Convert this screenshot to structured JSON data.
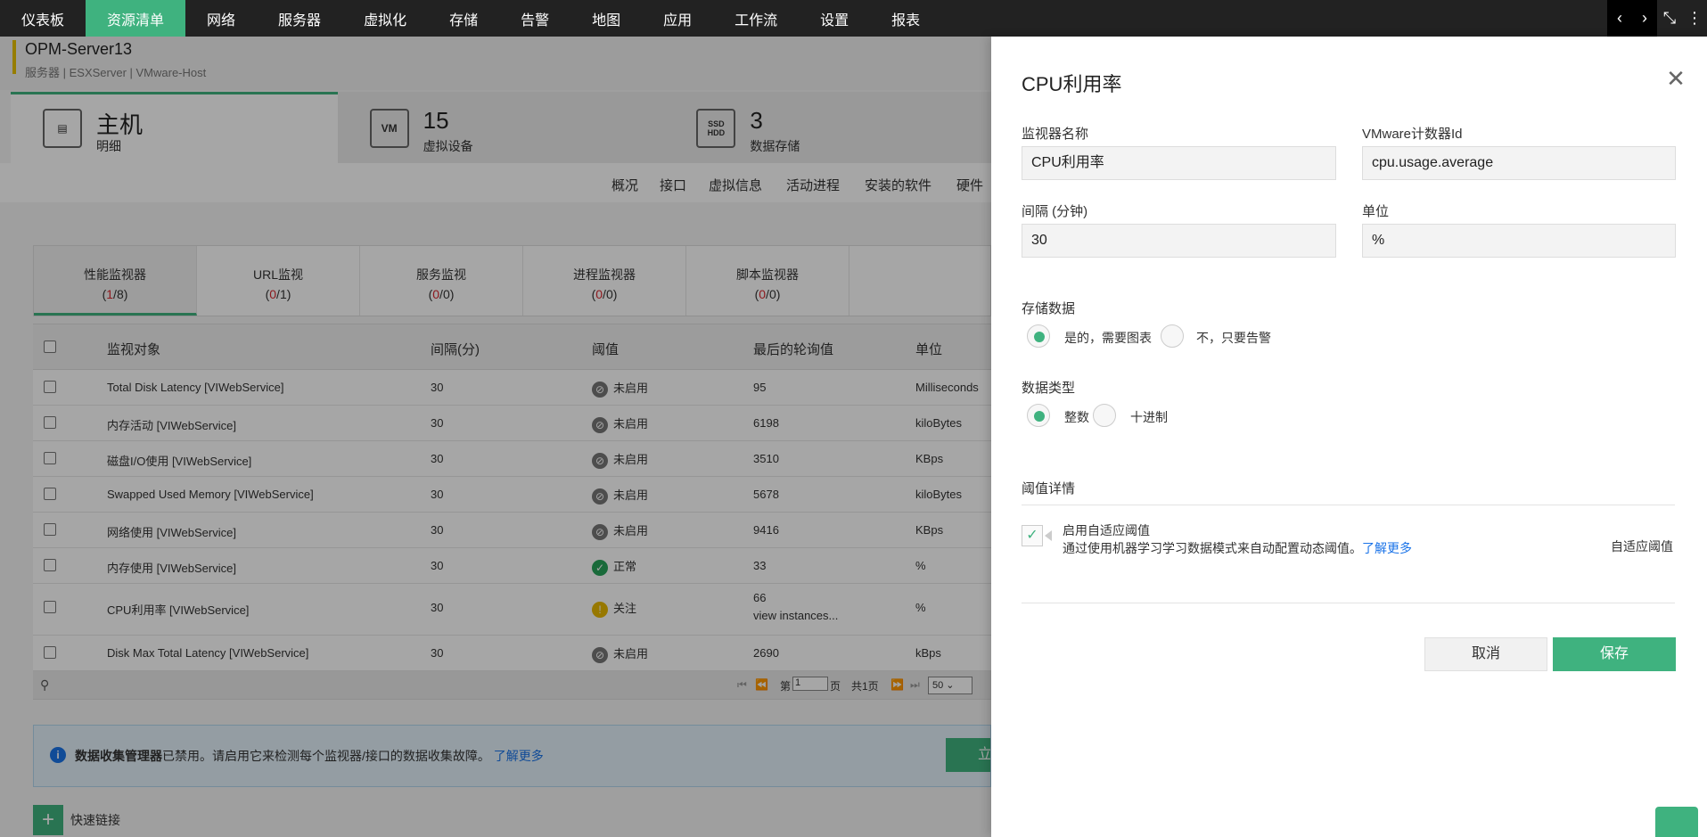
{
  "nav": {
    "items": [
      "仪表板",
      "资源清单",
      "网络",
      "服务器",
      "虚拟化",
      "存储",
      "告警",
      "地图",
      "应用",
      "工作流",
      "设置",
      "报表"
    ],
    "active_index": 1
  },
  "host": {
    "name": "OPM-Server13",
    "breadcrumb": "服务器 | ESXServer | VMware-Host"
  },
  "cards": [
    {
      "icon": "server-rack-icon",
      "big": "主机",
      "sub": "明细"
    },
    {
      "icon": "vm-icon",
      "icon_text": "VM",
      "big": "15",
      "sub": "虚拟设备"
    },
    {
      "icon": "hdd-icon",
      "icon_text": "SSD HDD",
      "big": "3",
      "sub": "数据存储"
    }
  ],
  "subtabs": [
    "概况",
    "接口",
    "虚拟信息",
    "活动进程",
    "安装的软件",
    "硬件"
  ],
  "monitor_tabs": [
    {
      "label": "性能监视器",
      "cnt_a": "1",
      "cnt_b": "8"
    },
    {
      "label": "URL监视",
      "cnt_a": "0",
      "cnt_b": "1"
    },
    {
      "label": "服务监视",
      "cnt_a": "0",
      "cnt_b": "0"
    },
    {
      "label": "进程监视器",
      "cnt_a": "0",
      "cnt_b": "0"
    },
    {
      "label": "脚本监视器",
      "cnt_a": "0",
      "cnt_b": "0"
    }
  ],
  "table": {
    "headers": [
      "监视对象",
      "间隔(分)",
      "阈值",
      "最后的轮询值",
      "单位"
    ],
    "rows": [
      {
        "name": "Total Disk Latency [VIWebService]",
        "interval": "30",
        "status": "未启用",
        "status_type": "disabled",
        "value": "95",
        "unit": "Milliseconds"
      },
      {
        "name": "内存活动 [VIWebService]",
        "interval": "30",
        "status": "未启用",
        "status_type": "disabled",
        "value": "6198",
        "unit": "kiloBytes"
      },
      {
        "name": "磁盘I/O使用 [VIWebService]",
        "interval": "30",
        "status": "未启用",
        "status_type": "disabled",
        "value": "3510",
        "unit": "KBps"
      },
      {
        "name": "Swapped Used Memory [VIWebService]",
        "interval": "30",
        "status": "未启用",
        "status_type": "disabled",
        "value": "5678",
        "unit": "kiloBytes"
      },
      {
        "name": "网络使用 [VIWebService]",
        "interval": "30",
        "status": "未启用",
        "status_type": "disabled",
        "value": "9416",
        "unit": "KBps"
      },
      {
        "name": "内存使用 [VIWebService]",
        "interval": "30",
        "status": "正常",
        "status_type": "ok",
        "value": "33",
        "unit": "%"
      },
      {
        "name": "CPU利用率 [VIWebService]",
        "interval": "30",
        "status": "关注",
        "status_type": "warn",
        "value": "66",
        "link": "view instances...",
        "unit": "%"
      },
      {
        "name": "Disk Max Total Latency [VIWebService]",
        "interval": "30",
        "status": "未启用",
        "status_type": "disabled",
        "value": "2690",
        "unit": "kBps"
      }
    ],
    "pager": {
      "prefix": "第",
      "page": "1",
      "suffix": "页",
      "total": "共1页",
      "per_page": "50"
    }
  },
  "notice": {
    "bold": "数据收集管理器",
    "text": "已禁用。请启用它来检测每个监视器/接口的数据收集故障。",
    "link": "了解更多",
    "button": "立"
  },
  "quick_link": "快速链接",
  "panel": {
    "title": "CPU利用率",
    "monitor_name_label": "监视器名称",
    "monitor_name_value": "CPU利用率",
    "counter_label": "VMware计数器Id",
    "counter_value": "cpu.usage.average",
    "interval_label": "间隔 (分钟)",
    "interval_value": "30",
    "unit_label": "单位",
    "unit_value": "%",
    "store_label": "存储数据",
    "store_yes": "是的，需要图表",
    "store_no": "不，只要告警",
    "dtype_label": "数据类型",
    "dtype_int": "整数",
    "dtype_dec": "十进制",
    "threshold_label": "阈值详情",
    "adaptive_title": "启用自适应阈值",
    "adaptive_desc": "通过使用机器学习学习数据模式来自动配置动态阈值。",
    "adaptive_link": "了解更多",
    "adaptive_right": "自适应阈值",
    "cancel": "取消",
    "save": "保存"
  }
}
